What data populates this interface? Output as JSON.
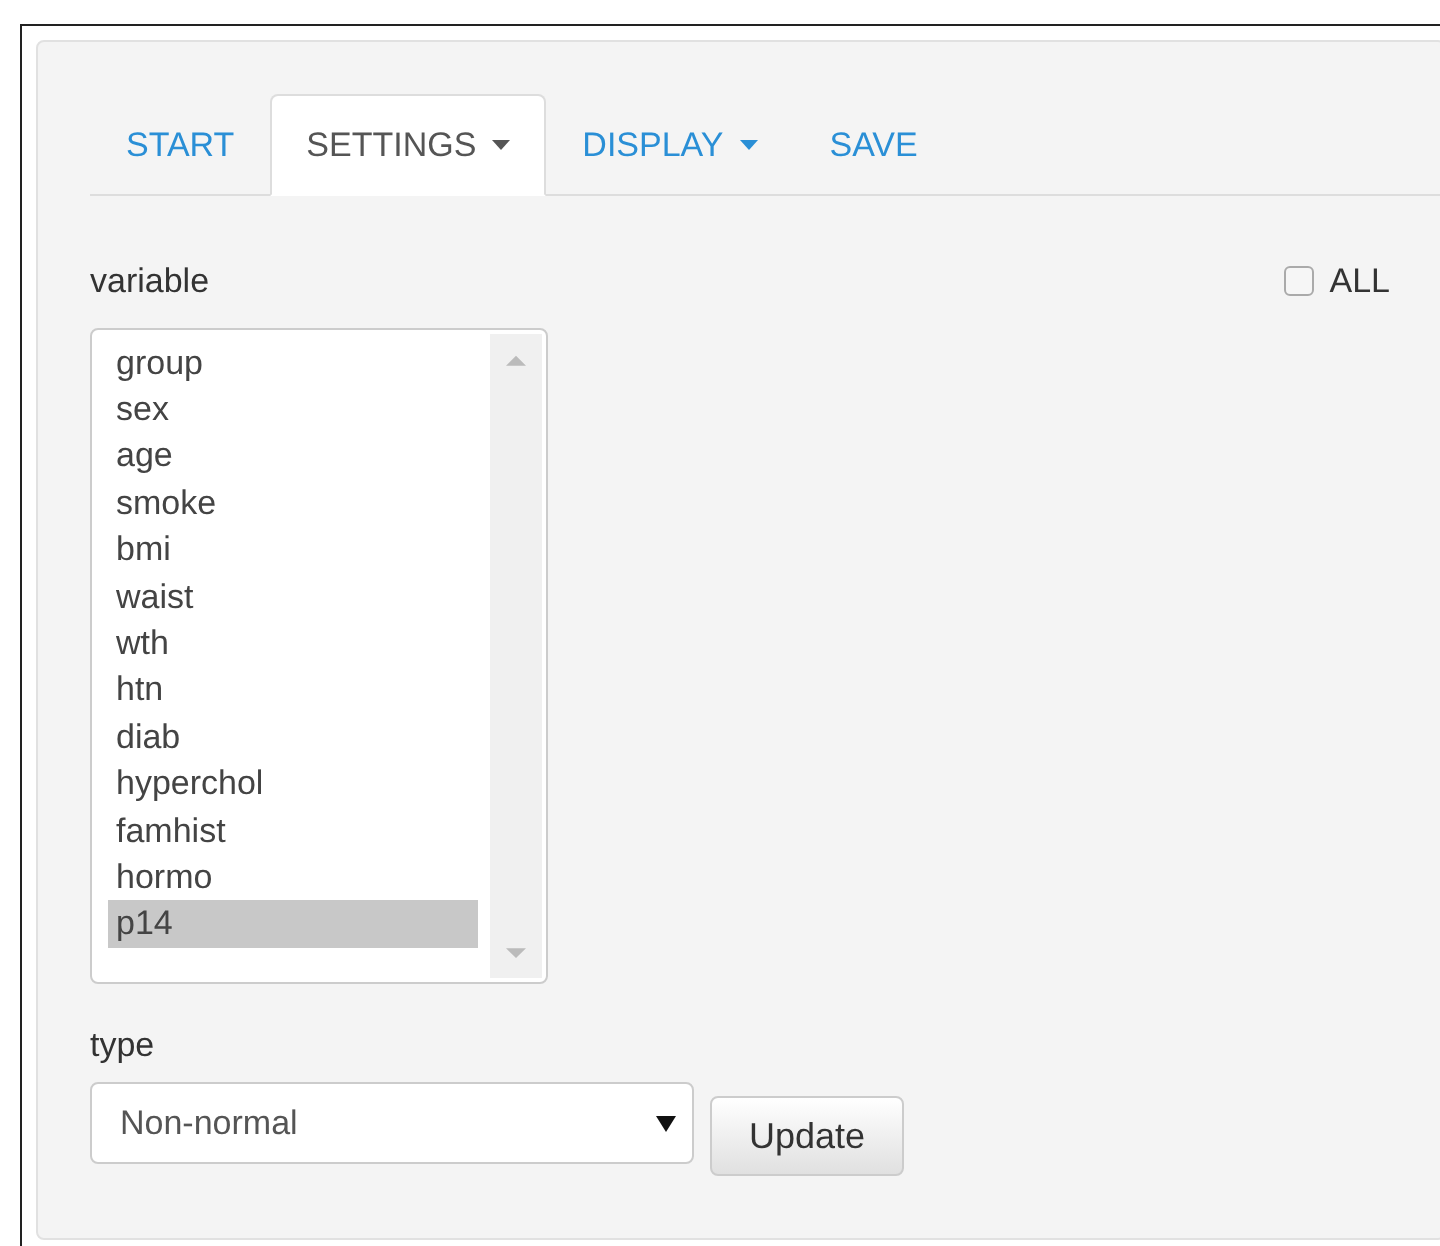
{
  "tabs": [
    {
      "label": "START",
      "kind": "link",
      "selected": false
    },
    {
      "label": "SETTINGS",
      "kind": "dropdown",
      "selected": true
    },
    {
      "label": "DISPLAY",
      "kind": "dropdown",
      "selected": false
    },
    {
      "label": "SAVE",
      "kind": "link",
      "selected": false
    }
  ],
  "variable": {
    "label": "variable",
    "items": [
      {
        "label": "group",
        "selected": false
      },
      {
        "label": "sex",
        "selected": false
      },
      {
        "label": "age",
        "selected": false
      },
      {
        "label": "smoke",
        "selected": false
      },
      {
        "label": "bmi",
        "selected": false
      },
      {
        "label": "waist",
        "selected": false
      },
      {
        "label": "wth",
        "selected": false
      },
      {
        "label": "htn",
        "selected": false
      },
      {
        "label": "diab",
        "selected": false
      },
      {
        "label": "hyperchol",
        "selected": false
      },
      {
        "label": "famhist",
        "selected": false
      },
      {
        "label": "hormo",
        "selected": false
      },
      {
        "label": "p14",
        "selected": true
      }
    ]
  },
  "all_checkbox": {
    "label": "ALL",
    "checked": false
  },
  "type": {
    "label": "type",
    "value": "Non-normal"
  },
  "update_button": "Update"
}
